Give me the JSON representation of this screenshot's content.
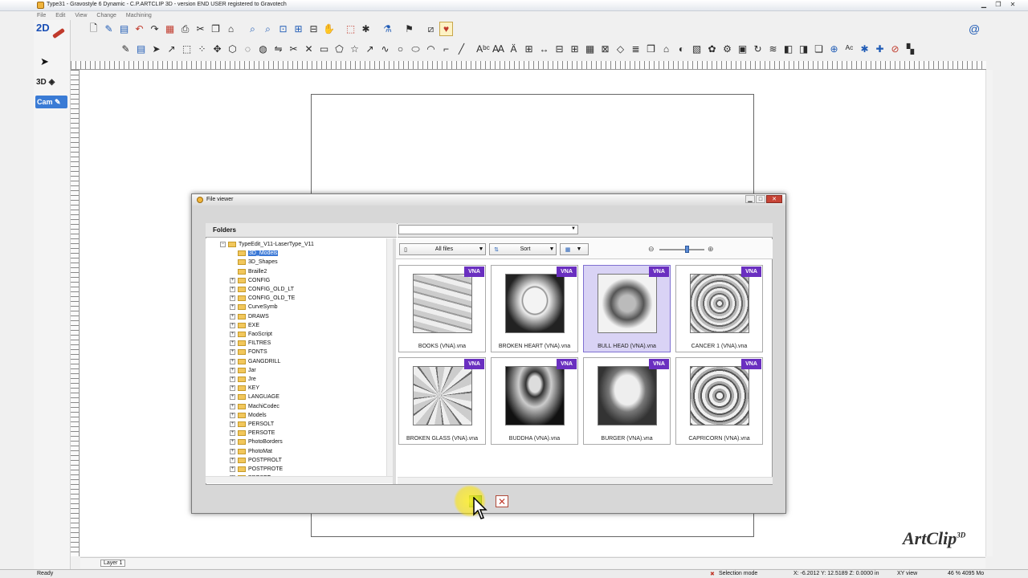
{
  "window": {
    "title": "Type31 - Gravostyle 6 Dynamic - C.P.ARTCLIP 3D - version END USER registered to Gravotech"
  },
  "menu": [
    "File",
    "Edit",
    "View",
    "Change",
    "Machining"
  ],
  "modes": {
    "twod": "2D",
    "threed": "3D",
    "cam": "Cam"
  },
  "canvas": {
    "layer": "Layer 1"
  },
  "status": {
    "ready": "Ready",
    "mode": "Selection mode",
    "coords": "X: -6.2012   Y: 12.5189   Z: 0.0000 in",
    "view": "XY view",
    "zoom": "46 % 4095 Mo"
  },
  "logo": {
    "text": "ArtClip",
    "sup": "3D"
  },
  "dialog": {
    "title": "File viewer",
    "folders_label": "Folders",
    "filter_label": "All files",
    "sort_label": "Sort",
    "tree": [
      {
        "label": "TypeEdit_V11-LaserType_V11",
        "indent": 0,
        "exp": "−",
        "selected": false
      },
      {
        "label": "3D_Models",
        "indent": 1,
        "exp": "",
        "selected": true
      },
      {
        "label": "3D_Shapes",
        "indent": 1,
        "exp": "",
        "selected": false
      },
      {
        "label": "Braille2",
        "indent": 1,
        "exp": "",
        "selected": false
      },
      {
        "label": "CONFIG",
        "indent": 1,
        "exp": "+",
        "selected": false
      },
      {
        "label": "CONFIG_OLD_LT",
        "indent": 1,
        "exp": "+",
        "selected": false
      },
      {
        "label": "CONFIG_OLD_TE",
        "indent": 1,
        "exp": "+",
        "selected": false
      },
      {
        "label": "CurveSymb",
        "indent": 1,
        "exp": "+",
        "selected": false
      },
      {
        "label": "DRAWS",
        "indent": 1,
        "exp": "+",
        "selected": false
      },
      {
        "label": "EXE",
        "indent": 1,
        "exp": "+",
        "selected": false
      },
      {
        "label": "FaoScript",
        "indent": 1,
        "exp": "+",
        "selected": false
      },
      {
        "label": "FILTRES",
        "indent": 1,
        "exp": "+",
        "selected": false
      },
      {
        "label": "FONTS",
        "indent": 1,
        "exp": "+",
        "selected": false
      },
      {
        "label": "GANGDRILL",
        "indent": 1,
        "exp": "+",
        "selected": false
      },
      {
        "label": "Jar",
        "indent": 1,
        "exp": "+",
        "selected": false
      },
      {
        "label": "Jre",
        "indent": 1,
        "exp": "+",
        "selected": false
      },
      {
        "label": "KEY",
        "indent": 1,
        "exp": "+",
        "selected": false
      },
      {
        "label": "LANGUAGE",
        "indent": 1,
        "exp": "+",
        "selected": false
      },
      {
        "label": "MachiCodec",
        "indent": 1,
        "exp": "+",
        "selected": false
      },
      {
        "label": "Models",
        "indent": 1,
        "exp": "+",
        "selected": false
      },
      {
        "label": "PERSOLT",
        "indent": 1,
        "exp": "+",
        "selected": false
      },
      {
        "label": "PERSOTE",
        "indent": 1,
        "exp": "+",
        "selected": false
      },
      {
        "label": "PhotoBorders",
        "indent": 1,
        "exp": "+",
        "selected": false
      },
      {
        "label": "PhotoMat",
        "indent": 1,
        "exp": "+",
        "selected": false
      },
      {
        "label": "POSTPROLT",
        "indent": 1,
        "exp": "+",
        "selected": false
      },
      {
        "label": "POSTPROTE",
        "indent": 1,
        "exp": "+",
        "selected": false
      },
      {
        "label": "PRESET",
        "indent": 1,
        "exp": "+",
        "selected": false
      }
    ],
    "files": [
      {
        "name": "BOOKS (VNA).vna",
        "tag": "VNA",
        "selected": false
      },
      {
        "name": "BROKEN HEART (VNA).vna",
        "tag": "VNA",
        "selected": false
      },
      {
        "name": "BULL HEAD  (VNA).vna",
        "tag": "VNA",
        "selected": true
      },
      {
        "name": "CANCER 1 (VNA).vna",
        "tag": "VNA",
        "selected": false
      },
      {
        "name": "BROKEN GLASS (VNA).vna",
        "tag": "VNA",
        "selected": false
      },
      {
        "name": "BUDDHA  (VNA).vna",
        "tag": "VNA",
        "selected": false
      },
      {
        "name": "BURGER (VNA).vna",
        "tag": "VNA",
        "selected": false
      },
      {
        "name": "CAPRICORN (VNA).vna",
        "tag": "VNA",
        "selected": false
      }
    ]
  }
}
